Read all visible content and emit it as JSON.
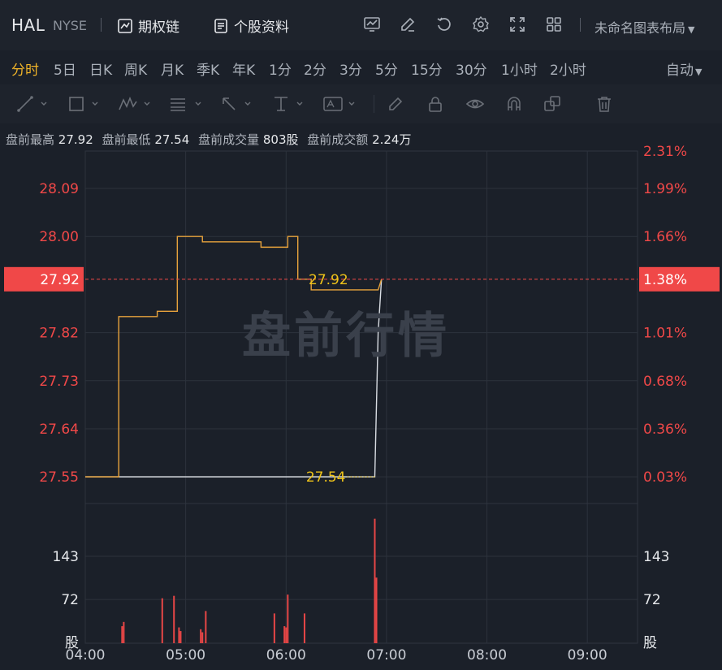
{
  "header": {
    "symbol": "HAL",
    "exchange": "NYSE",
    "options_chain_label": "期权链",
    "stock_profile_label": "个股资料",
    "layout_label": "未命名图表布局"
  },
  "periods": [
    "分时",
    "5日",
    "日K",
    "周K",
    "月K",
    "季K",
    "年K",
    "1分",
    "2分",
    "3分",
    "5分",
    "15分",
    "30分",
    "1小时",
    "2小时"
  ],
  "active_period": "分时",
  "auto_label": "自动",
  "info": {
    "high_label": "盘前最高",
    "high_value": "27.92",
    "low_label": "盘前最低",
    "low_value": "27.54",
    "volume_label": "盘前成交量",
    "volume_value": "803股",
    "amount_label": "盘前成交额",
    "amount_value": "2.24万"
  },
  "watermark": "盘前行情",
  "colors": {
    "price_line": "#e8a33c",
    "avg_line": "#d9dde3",
    "axis_red": "#f04848",
    "current_marker": "#f04848",
    "label_yellow": "#f0c419",
    "volume_bar": "#e84646"
  },
  "chart_data": {
    "type": "line",
    "title": "",
    "x_ticks": [
      "04:00",
      "05:00",
      "06:00",
      "07:00",
      "08:00",
      "09:00"
    ],
    "y_left_ticks": [
      "28.09",
      "28.00",
      "27.92",
      "27.82",
      "27.73",
      "27.64",
      "27.55"
    ],
    "y_right_ticks": [
      "2.31%",
      "1.99%",
      "1.66%",
      "1.38%",
      "1.01%",
      "0.68%",
      "0.36%",
      "0.03%"
    ],
    "current_price": "27.92",
    "current_pct": "1.38%",
    "high_label": "27.92",
    "low_label": "27.54",
    "ylim": [
      27.5,
      28.16
    ],
    "series": [
      {
        "name": "price",
        "x": [
          "04:00",
          "04:20",
          "04:20",
          "04:43",
          "04:43",
          "04:55",
          "04:55",
          "05:10",
          "05:10",
          "05:45",
          "05:45",
          "05:50",
          "05:50",
          "05:55",
          "05:55",
          "06:00",
          "06:00",
          "06:01",
          "06:01",
          "06:02",
          "06:02",
          "06:06",
          "06:06",
          "06:07",
          "06:07",
          "06:12",
          "06:12",
          "06:13",
          "06:13",
          "06:15",
          "06:15",
          "06:55",
          "06:55",
          "06:57"
        ],
        "y": [
          27.55,
          27.55,
          27.85,
          27.85,
          27.86,
          27.86,
          28.0,
          28.0,
          27.99,
          27.99,
          27.98,
          27.98,
          27.98,
          27.98,
          27.98,
          27.98,
          27.98,
          27.98,
          28.0,
          28.0,
          28.0,
          28.0,
          28.0,
          28.0,
          27.92,
          27.92,
          27.92,
          27.92,
          27.92,
          27.92,
          27.9,
          27.9,
          27.9,
          27.92
        ]
      },
      {
        "name": "average",
        "x": [
          "04:00",
          "06:53",
          "06:55",
          "06:57"
        ],
        "y": [
          27.55,
          27.55,
          27.82,
          27.92
        ]
      }
    ],
    "volume": {
      "y_ticks": [
        "143",
        "72"
      ],
      "unit": "股",
      "bars": [
        {
          "t": "04:22",
          "v": 28
        },
        {
          "t": "04:23",
          "v": 35
        },
        {
          "t": "04:46",
          "v": 74
        },
        {
          "t": "04:53",
          "v": 78
        },
        {
          "t": "04:56",
          "v": 26
        },
        {
          "t": "04:57",
          "v": 20
        },
        {
          "t": "05:09",
          "v": 23
        },
        {
          "t": "05:10",
          "v": 18
        },
        {
          "t": "05:12",
          "v": 53
        },
        {
          "t": "05:53",
          "v": 49
        },
        {
          "t": "05:59",
          "v": 28
        },
        {
          "t": "06:00",
          "v": 26
        },
        {
          "t": "06:01",
          "v": 80
        },
        {
          "t": "06:11",
          "v": 49
        },
        {
          "t": "06:53",
          "v": 205
        },
        {
          "t": "06:54",
          "v": 108
        }
      ]
    }
  }
}
